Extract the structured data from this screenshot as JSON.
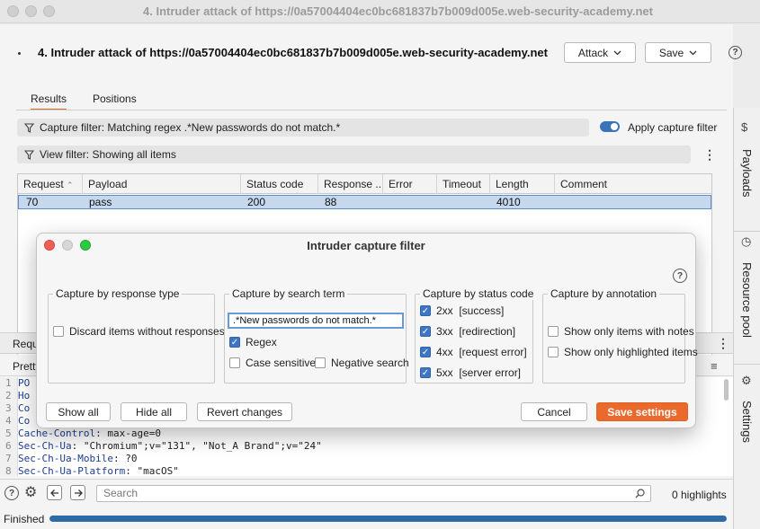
{
  "window": {
    "title": "4. Intruder attack of https://0a57004404ec0bc681837b7b009d005e.web-security-academy.net"
  },
  "header": {
    "title": "4. Intruder attack of https://0a57004404ec0bc681837b7b009d005e.web-security-academy.net",
    "attack_label": "Attack",
    "save_label": "Save",
    "help_glyph": "?"
  },
  "tabs": [
    {
      "label": "Results",
      "active": true
    },
    {
      "label": "Positions",
      "active": false
    }
  ],
  "capture_filter": {
    "text": "Capture filter: Matching regex .*New passwords do not match.*",
    "apply_label": "Apply capture filter",
    "apply_enabled": true
  },
  "view_filter": {
    "text": "View filter: Showing all items"
  },
  "results_table": {
    "columns": [
      "Request",
      "Payload",
      "Status code",
      "Response ...",
      "Error",
      "Timeout",
      "Length",
      "Comment"
    ],
    "rows": [
      {
        "request": "70",
        "payload": "pass",
        "status": "200",
        "response": "88",
        "error": "",
        "timeout": "",
        "length": "4010",
        "comment": ""
      }
    ]
  },
  "request_panel": {
    "tab_label": "Requ",
    "view_label": "Pretty",
    "lines": [
      {
        "n": "1",
        "key": "PO",
        "sep": "",
        "val": ""
      },
      {
        "n": "2",
        "key": "Ho",
        "sep": "",
        "val": ""
      },
      {
        "n": "3",
        "key": "Co",
        "sep": "",
        "val": ""
      },
      {
        "n": "4",
        "key": "Co",
        "sep": "",
        "val": ""
      },
      {
        "n": "5",
        "key": "Cache-Control",
        "sep": ": ",
        "val": "max-age=0"
      },
      {
        "n": "6",
        "key": "Sec-Ch-Ua",
        "sep": ": ",
        "val": "\"Chromium\";v=\"131\", \"Not_A Brand\";v=\"24\""
      },
      {
        "n": "7",
        "key": "Sec-Ch-Ua-Mobile",
        "sep": ": ",
        "val": "?0"
      },
      {
        "n": "8",
        "key": "Sec-Ch-Ua-Platform",
        "sep": ": ",
        "val": "\"macOS\""
      }
    ]
  },
  "bottom": {
    "search_placeholder": "Search",
    "highlights": "0 highlights",
    "status": "Finished",
    "progress": 1.0
  },
  "sidebar": [
    {
      "label": "Payloads",
      "icon": "$"
    },
    {
      "label": "Resource pool",
      "icon": "◷"
    },
    {
      "label": "Settings",
      "icon": "⚙"
    }
  ],
  "modal": {
    "title": "Intruder capture filter",
    "help_glyph": "?",
    "response_type": {
      "legend": "Capture by response type",
      "options": [
        {
          "label": "Discard items without responses",
          "checked": false
        }
      ]
    },
    "search_term": {
      "legend": "Capture by search term",
      "value": ".*New passwords do not match.*",
      "regex": {
        "label": "Regex",
        "checked": true
      },
      "case_sensitive": {
        "label": "Case sensitive",
        "checked": false
      },
      "negative": {
        "label": "Negative search",
        "checked": false
      }
    },
    "status_code": {
      "legend": "Capture by status code",
      "options": [
        {
          "label": "2xx  [success]",
          "checked": true
        },
        {
          "label": "3xx  [redirection]",
          "checked": true
        },
        {
          "label": "4xx  [request error]",
          "checked": true
        },
        {
          "label": "5xx  [server error]",
          "checked": true
        }
      ]
    },
    "annotation": {
      "legend": "Capture by annotation",
      "options": [
        {
          "label": "Show only items with notes",
          "checked": false
        },
        {
          "label": "Show only highlighted items",
          "checked": false
        }
      ]
    },
    "buttons": {
      "show_all": "Show all",
      "hide_all": "Hide all",
      "revert": "Revert changes",
      "cancel": "Cancel",
      "save": "Save settings"
    }
  },
  "colors": {
    "accent": "#ea6a2d",
    "selection": "#c5d8ee",
    "toggle": "#3b73b9",
    "checkbox": "#3c76c4"
  }
}
